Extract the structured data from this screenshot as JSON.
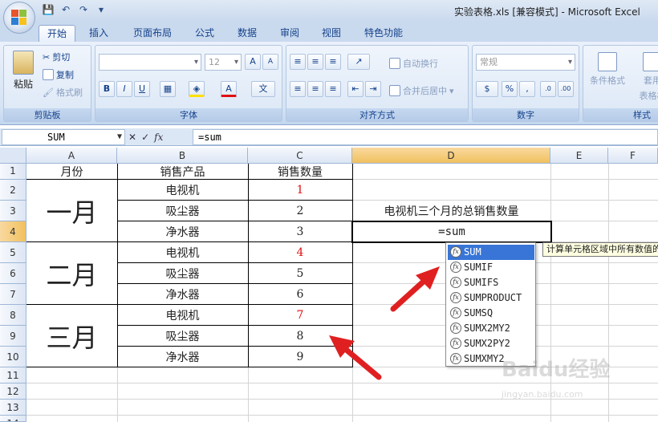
{
  "window": {
    "title": "实验表格.xls  [兼容模式] - Microsoft Excel"
  },
  "ribbon_tabs": [
    "开始",
    "插入",
    "页面布局",
    "公式",
    "数据",
    "审阅",
    "视图",
    "特色功能"
  ],
  "ribbon": {
    "clipboard": {
      "title": "剪贴板",
      "paste": "粘贴",
      "cut": "剪切",
      "copy": "复制",
      "format_painter": "格式刷"
    },
    "font": {
      "title": "字体",
      "size": "12"
    },
    "alignment": {
      "title": "对齐方式",
      "wrap": "自动换行",
      "merge": "合并后居中"
    },
    "number": {
      "title": "数字",
      "format": "常规"
    },
    "styles": {
      "cond_format": "条件格式",
      "table_format_1": "套用",
      "table_format_2": "表格格",
      "title": "样式"
    }
  },
  "formula_bar": {
    "name_box": "SUM",
    "fx_label": "fx",
    "content": "=sum"
  },
  "columns": [
    "A",
    "B",
    "C",
    "D",
    "E",
    "F"
  ],
  "rows": [
    "1",
    "2",
    "3",
    "4",
    "5",
    "6",
    "7",
    "8",
    "9",
    "10",
    "11",
    "12",
    "13",
    "14"
  ],
  "headers": {
    "month": "月份",
    "product": "销售产品",
    "quantity": "销售数量"
  },
  "months": [
    "一月",
    "二月",
    "三月"
  ],
  "data_rows": [
    {
      "product": "电视机",
      "quantity": "1",
      "highlight": true
    },
    {
      "product": "吸尘器",
      "quantity": "2",
      "highlight": false
    },
    {
      "product": "净水器",
      "quantity": "3",
      "highlight": false
    },
    {
      "product": "电视机",
      "quantity": "4",
      "highlight": true
    },
    {
      "product": "吸尘器",
      "quantity": "5",
      "highlight": false
    },
    {
      "product": "净水器",
      "quantity": "6",
      "highlight": false
    },
    {
      "product": "电视机",
      "quantity": "7",
      "highlight": true
    },
    {
      "product": "吸尘器",
      "quantity": "8",
      "highlight": false
    },
    {
      "product": "净水器",
      "quantity": "9",
      "highlight": false
    }
  ],
  "d3_label": "电视机三个月的总销售数量",
  "d4_value": "=sum",
  "autocomplete": {
    "items": [
      "SUM",
      "SUMIF",
      "SUMIFS",
      "SUMPRODUCT",
      "SUMSQ",
      "SUMX2MY2",
      "SUMX2PY2",
      "SUMXMY2"
    ],
    "selected": "SUM",
    "tooltip": "计算单元格区域中所有数值的和"
  },
  "colors": {
    "accent": "#3875d7",
    "highlight_number": "#e01010",
    "arrow": "#e02020"
  },
  "watermark": {
    "text": "Baidu经验",
    "sub": "jingyan.baidu.com"
  }
}
